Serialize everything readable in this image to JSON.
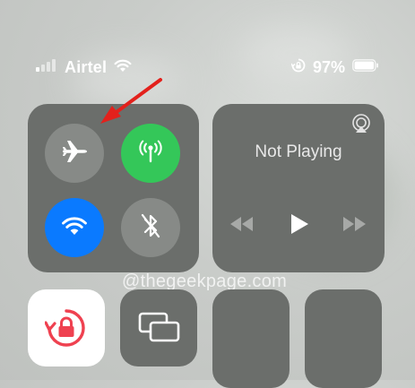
{
  "status": {
    "carrier": "Airtel",
    "battery_percent": "97%",
    "battery_level": 0.97
  },
  "connectivity": {
    "airplane_mode": false,
    "cellular_data": true,
    "wifi": true,
    "bluetooth": false
  },
  "media": {
    "title": "Not Playing"
  },
  "watermark": "@thegeekpage.com",
  "colors": {
    "green": "#34c759",
    "blue": "#0a7aff",
    "gray_button": "#878a87",
    "annotation_arrow": "#e3211c",
    "lock_icon": "#ef4150"
  }
}
